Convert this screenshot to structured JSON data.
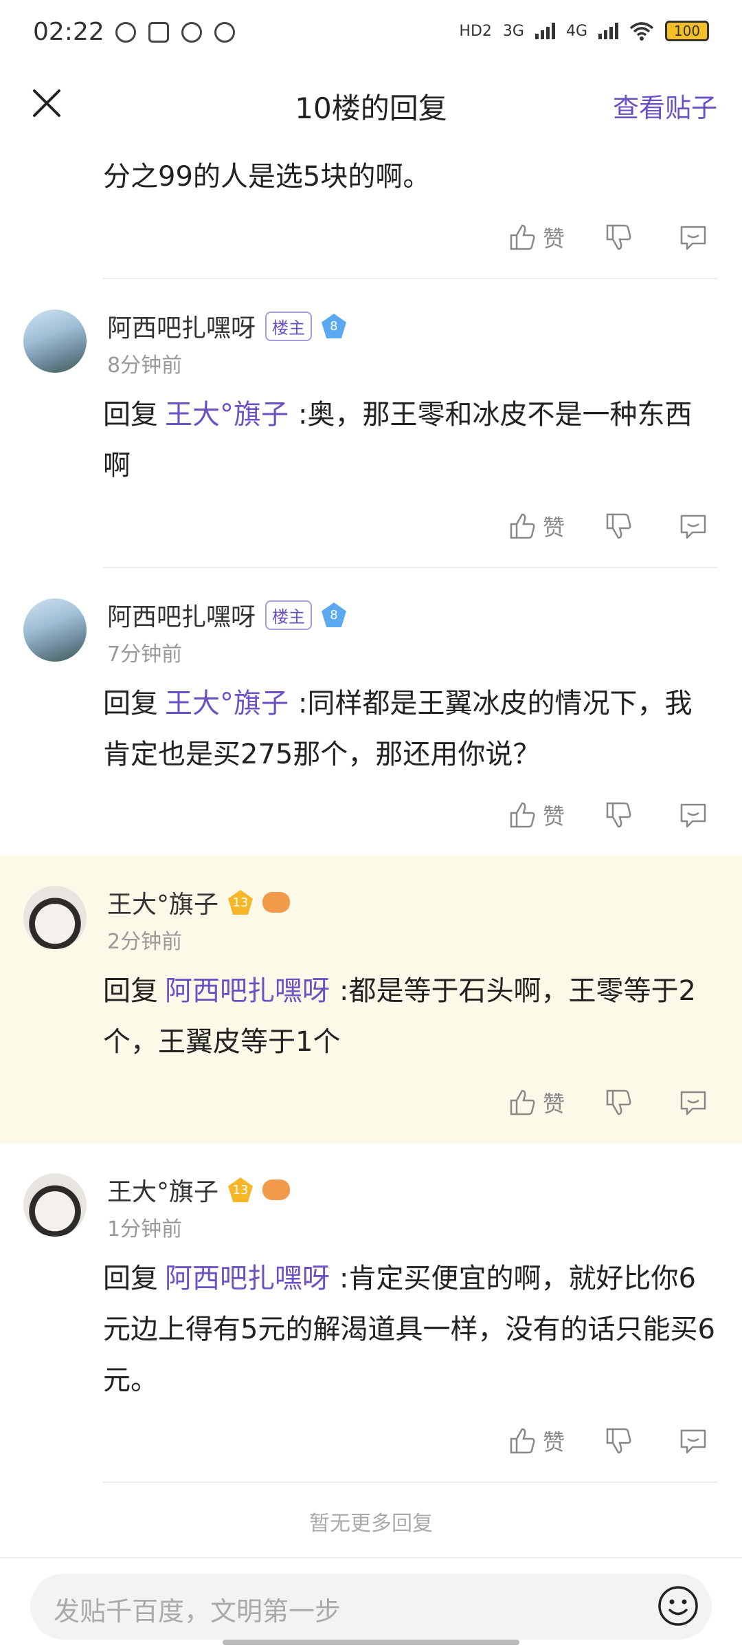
{
  "status_bar": {
    "time": "02:22",
    "battery": "100",
    "network": [
      "HD2",
      "3G",
      "4G"
    ]
  },
  "header": {
    "title": "10楼的回复",
    "link": "查看贴子"
  },
  "top_reply": {
    "text": "分之99的人是选5块的啊。"
  },
  "actions": {
    "like_label": "赞"
  },
  "replies": [
    {
      "username": "阿西吧扎嘿呀",
      "owner_badge": "楼主",
      "level": "8",
      "time": "8分钟前",
      "prefix": "回复",
      "mention": "王大°旗子",
      "text": ":奥，那王零和冰皮不是一种东西啊"
    },
    {
      "username": "阿西吧扎嘿呀",
      "owner_badge": "楼主",
      "level": "8",
      "time": "7分钟前",
      "prefix": "回复",
      "mention": "王大°旗子",
      "text": ":同样都是王翼冰皮的情况下，我肯定也是买275那个，那还用你说？"
    },
    {
      "username": "王大°旗子",
      "level": "13",
      "time": "2分钟前",
      "prefix": "回复",
      "mention": "阿西吧扎嘿呀",
      "text": ":都是等于石头啊，王零等于2个，王翼皮等于1个"
    },
    {
      "username": "王大°旗子",
      "level": "13",
      "time": "1分钟前",
      "prefix": "回复",
      "mention": "阿西吧扎嘿呀",
      "text": ":肯定买便宜的啊，就好比你6元边上得有5元的解渴道具一样，没有的话只能买6元。"
    }
  ],
  "footer_note": "暂无更多回复",
  "input": {
    "placeholder": "发贴千百度，文明第一步"
  }
}
